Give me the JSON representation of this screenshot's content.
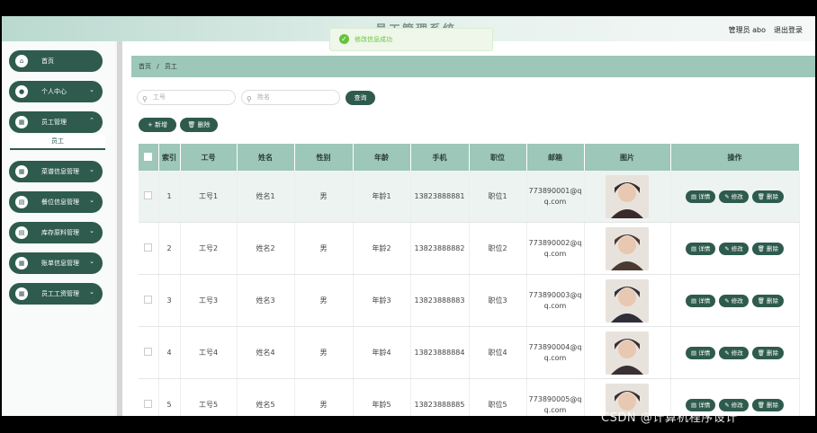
{
  "header": {
    "title": "员工管理系统",
    "user": "管理员 abo",
    "logout": "退出登录"
  },
  "toast": {
    "icon": "check-icon",
    "message": "修改信息成功"
  },
  "sidebar": {
    "items": [
      {
        "label": "首页",
        "icon": "home-icon"
      },
      {
        "label": "个人中心",
        "icon": "user-icon"
      },
      {
        "label": "员工管理",
        "icon": "grid-icon"
      },
      {
        "label": "菜谱信息管理",
        "icon": "grid-icon"
      },
      {
        "label": "餐位信息管理",
        "icon": "file-icon"
      },
      {
        "label": "库存原料管理",
        "icon": "file-icon"
      },
      {
        "label": "账单信息管理",
        "icon": "grid-icon"
      },
      {
        "label": "员工工资管理",
        "icon": "grid-icon"
      }
    ],
    "sub_item": "员工"
  },
  "breadcrumb": {
    "home": "首页",
    "sep": "/",
    "current": "员工"
  },
  "search": {
    "no_placeholder": "工号",
    "name_placeholder": "姓名",
    "button": "查询"
  },
  "actions": {
    "add": "+ 新增",
    "delete": "删除"
  },
  "table": {
    "columns": [
      "索引",
      "工号",
      "姓名",
      "性别",
      "年龄",
      "手机",
      "职位",
      "邮箱",
      "图片",
      "操作"
    ],
    "rows": [
      {
        "index": "1",
        "no": "工号1",
        "name": "姓名1",
        "gender": "男",
        "age": "年龄1",
        "phone": "13823888881",
        "position": "职位1",
        "email1": "773890001@q",
        "email2": "q.com"
      },
      {
        "index": "2",
        "no": "工号2",
        "name": "姓名2",
        "gender": "男",
        "age": "年龄2",
        "phone": "13823888882",
        "position": "职位2",
        "email1": "773890002@q",
        "email2": "q.com"
      },
      {
        "index": "3",
        "no": "工号3",
        "name": "姓名3",
        "gender": "男",
        "age": "年龄3",
        "phone": "13823888883",
        "position": "职位3",
        "email1": "773890003@q",
        "email2": "q.com"
      },
      {
        "index": "4",
        "no": "工号4",
        "name": "姓名4",
        "gender": "男",
        "age": "年龄4",
        "phone": "13823888884",
        "position": "职位4",
        "email1": "773890004@q",
        "email2": "q.com"
      },
      {
        "index": "5",
        "no": "工号5",
        "name": "姓名5",
        "gender": "男",
        "age": "年龄5",
        "phone": "13823888885",
        "position": "职位5",
        "email1": "773890005@q",
        "email2": "q.com"
      }
    ],
    "ops": {
      "detail": "详情",
      "edit": "修改",
      "delete": "删除"
    }
  },
  "watermark": "CSDN @计算机程序设计"
}
